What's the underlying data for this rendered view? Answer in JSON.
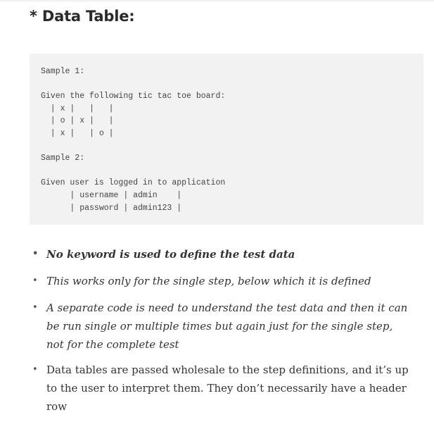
{
  "section": {
    "heading": "* Data Table:"
  },
  "code": {
    "lines": [
      "Sample 1:",
      "",
      "Given the following tic tac toe board:",
      "  | x |   |   |",
      "  | o | x |   |",
      "  | x |   | o |",
      "",
      "Sample 2:",
      "",
      "Given user is logged in to application",
      "      | username | admin    |",
      "      | password | admin123 |"
    ]
  },
  "bullets": [
    {
      "marker": "•",
      "text": "No keyword is used to define the test data"
    },
    {
      "marker": "•",
      "text": "This works only for the single step, below which it is defined"
    },
    {
      "marker": "•",
      "text": "A separate code is need to understand the test data and then it can be run single or multiple times but again just for the single step, not for the complete test"
    },
    {
      "marker": "•",
      "text": "Data tables are passed wholesale to the step definitions, and it’s up to the user to interpret them. They don’t necessarily have a header row"
    }
  ]
}
